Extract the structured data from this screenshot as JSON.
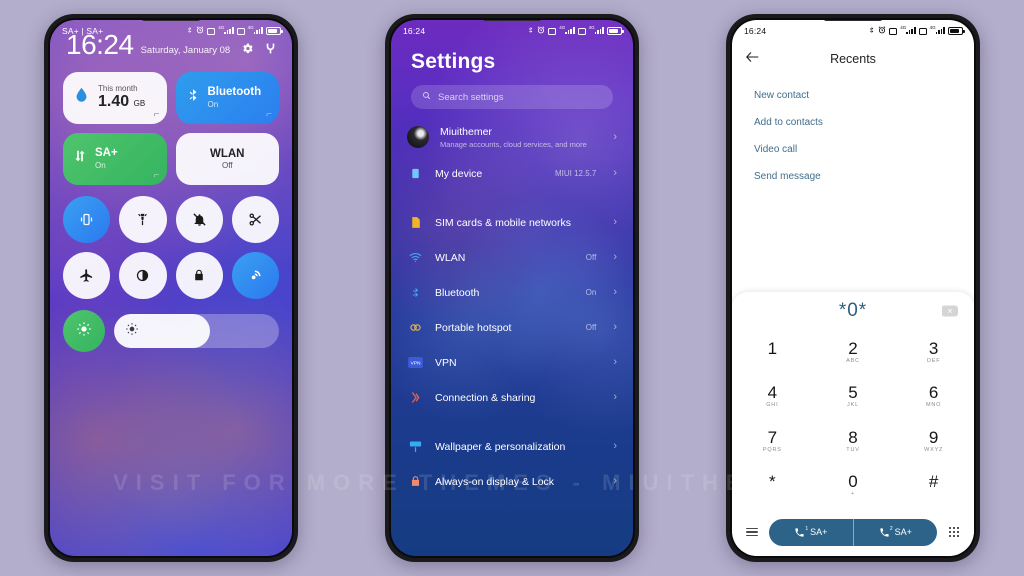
{
  "watermark": "VISIT FOR MORE THEMES  -  MIUITHEMER.COM",
  "statusbar": {
    "time": "16:24",
    "carrier_left": "SA+ | SA+",
    "icons": [
      "bluetooth-icon",
      "alarm-icon",
      "sim1-icon",
      "signal-4g-icon",
      "sim2-icon",
      "signal-4g-icon",
      "battery-icon"
    ],
    "network_label": "4G"
  },
  "control_center": {
    "time": "16:24",
    "date": "Saturday, January 08",
    "header_icons": [
      "settings-gear-icon",
      "edit-toggles-icon"
    ],
    "tiles": [
      {
        "kind": "data",
        "sub": "This month",
        "value": "1.40",
        "unit": "GB",
        "icon": "data-usage-drop-icon",
        "style": "white"
      },
      {
        "kind": "toggle",
        "title": "Bluetooth",
        "state": "On",
        "icon": "bluetooth-icon",
        "style": "blue"
      },
      {
        "kind": "toggle",
        "title": "SA+",
        "state": "On",
        "icon": "mobile-data-icon",
        "style": "green"
      },
      {
        "kind": "toggle",
        "title": "WLAN",
        "state": "Off",
        "icon": "wifi-icon",
        "style": "white"
      }
    ],
    "toggles": [
      {
        "name": "vibrate-icon",
        "on": true
      },
      {
        "name": "flashlight-icon",
        "on": false
      },
      {
        "name": "mute-icon",
        "on": false
      },
      {
        "name": "screenshot-scissors-icon",
        "on": false
      },
      {
        "name": "airplane-mode-icon",
        "on": false
      },
      {
        "name": "dark-mode-icon",
        "on": false
      },
      {
        "name": "lock-icon",
        "on": false
      },
      {
        "name": "cast-icon",
        "on": true
      }
    ],
    "brightness": {
      "icon": "auto-brightness-icon",
      "slider_icon": "brightness-icon",
      "level": 58
    }
  },
  "settings": {
    "title": "Settings",
    "search_placeholder": "Search settings",
    "account": {
      "name": "Miuithemer",
      "subtitle": "Manage accounts, cloud services, and more",
      "icon": "avatar"
    },
    "items": [
      {
        "label": "My device",
        "value": "MIUI 12.5.7",
        "icon": "device-icon",
        "group": 0
      },
      {
        "label": "SIM cards & mobile networks",
        "value": "",
        "icon": "sim-card-icon",
        "group": 1
      },
      {
        "label": "WLAN",
        "value": "Off",
        "icon": "wifi-icon",
        "group": 1
      },
      {
        "label": "Bluetooth",
        "value": "On",
        "icon": "bluetooth-icon",
        "group": 1
      },
      {
        "label": "Portable hotspot",
        "value": "Off",
        "icon": "hotspot-icon",
        "group": 1
      },
      {
        "label": "VPN",
        "value": "",
        "icon": "vpn-icon",
        "group": 1
      },
      {
        "label": "Connection & sharing",
        "value": "",
        "icon": "sharing-icon",
        "group": 1
      },
      {
        "label": "Wallpaper & personalization",
        "value": "",
        "icon": "wallpaper-icon",
        "group": 2
      },
      {
        "label": "Always-on display & Lock",
        "value": "",
        "icon": "lock-screen-icon",
        "group": 2
      }
    ],
    "chevron": "›"
  },
  "dialer": {
    "title": "Recents",
    "back_icon": "arrow-left-icon",
    "actions": [
      "New contact",
      "Add to contacts",
      "Video call",
      "Send message"
    ],
    "number": "*0*",
    "delete_icon": "backspace-icon",
    "keys": [
      {
        "digit": "1",
        "letters": ""
      },
      {
        "digit": "2",
        "letters": "ABC"
      },
      {
        "digit": "3",
        "letters": "DEF"
      },
      {
        "digit": "4",
        "letters": "GHI"
      },
      {
        "digit": "5",
        "letters": "JKL"
      },
      {
        "digit": "6",
        "letters": "MNO"
      },
      {
        "digit": "7",
        "letters": "PQRS"
      },
      {
        "digit": "8",
        "letters": "TUV"
      },
      {
        "digit": "9",
        "letters": "WXYZ"
      },
      {
        "digit": "*",
        "letters": ""
      },
      {
        "digit": "0",
        "letters": "+"
      },
      {
        "digit": "#",
        "letters": ""
      }
    ],
    "call_buttons": [
      {
        "label": "SA+",
        "sim": "1",
        "icon": "call-icon"
      },
      {
        "label": "SA+",
        "sim": "2",
        "icon": "call-icon"
      }
    ],
    "left_icon": "menu-icon",
    "right_icon": "keypad-icon"
  },
  "colors": {
    "page_background": "#b3aecb",
    "settings_top": "#6d2bbf",
    "settings_bottom": "#153c82",
    "accent_blue": "#2b79ef",
    "accent_green": "#35b45f",
    "dialer_accent": "#2e6389",
    "dialer_link": "#416e8c"
  }
}
